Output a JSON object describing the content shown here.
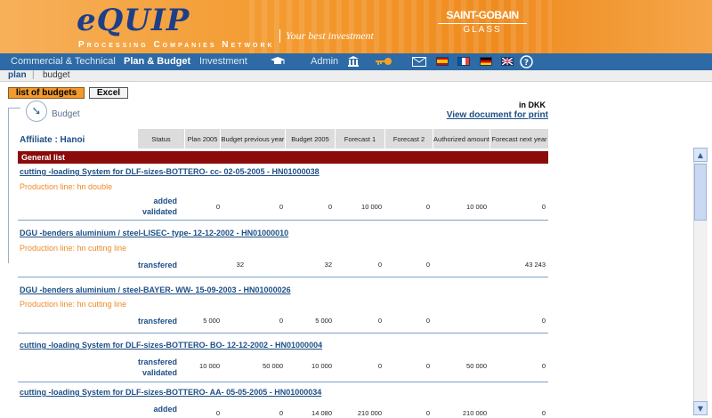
{
  "header": {
    "logo": "eQUIP",
    "logo_sub": "Processing Companies Network",
    "tagline": "Your best investment",
    "brand_top": "SAINT-GOBAIN",
    "brand_bottom": "GLASS"
  },
  "nav": {
    "items": [
      "Commercial & Technical",
      "Plan & Budget",
      "Investment",
      "Admin"
    ],
    "active": "Plan & Budget"
  },
  "subnav": {
    "crumbs": [
      "plan",
      "budget"
    ]
  },
  "toolbar": {
    "list_of_budgets": "list of budgets",
    "excel": "Excel"
  },
  "budget": {
    "title": "Budget",
    "currency": "in DKK",
    "print_link": "View document for print",
    "affiliate": "Affiliate : Hanoi",
    "columns": [
      "Status",
      "Plan 2005",
      "Budget previous year",
      "Budget 2005",
      "Forecast 1",
      "Forecast 2",
      "Authorized amount",
      "Forecast next year"
    ],
    "general_list": "General list",
    "rows": [
      {
        "title": "cutting -loading System for DLF-sizes-BOTTERO- cc- 02-05-2005 - HN01000038",
        "production_line": "Production line: hn double",
        "status": [
          "added",
          "validated"
        ],
        "values": [
          "0",
          "0",
          "0",
          "10 000",
          "0",
          "10 000",
          "0"
        ]
      },
      {
        "title": "DGU -benders aluminium / steel-LISEC- type- 12-12-2002 - HN01000010",
        "production_line": "Production line: hn cutting line",
        "status": [
          "transfered"
        ],
        "values": [
          "32",
          "",
          "32",
          "0",
          "0",
          "",
          "43 243"
        ]
      },
      {
        "title": "DGU -benders aluminium / steel-BAYER- WW- 15-09-2003 - HN01000026",
        "production_line": "Production line: hn cutting line",
        "status": [
          "transfered"
        ],
        "values": [
          "5 000",
          "0",
          "5 000",
          "0",
          "0",
          "",
          "0"
        ]
      },
      {
        "title": "cutting -loading System for DLF-sizes-BOTTERO- BO- 12-12-2002 - HN01000004",
        "production_line": "",
        "status": [
          "transfered",
          "validated"
        ],
        "values": [
          "10 000",
          "50 000",
          "10 000",
          "0",
          "0",
          "50 000",
          "0"
        ]
      },
      {
        "title": "cutting -loading System for DLF-sizes-BOTTERO- AA- 05-05-2005 - HN01000034",
        "production_line": "",
        "status": [
          "added"
        ],
        "values": [
          "0",
          "0",
          "14 080",
          "210 000",
          "0",
          "210 000",
          "0"
        ]
      }
    ]
  }
}
